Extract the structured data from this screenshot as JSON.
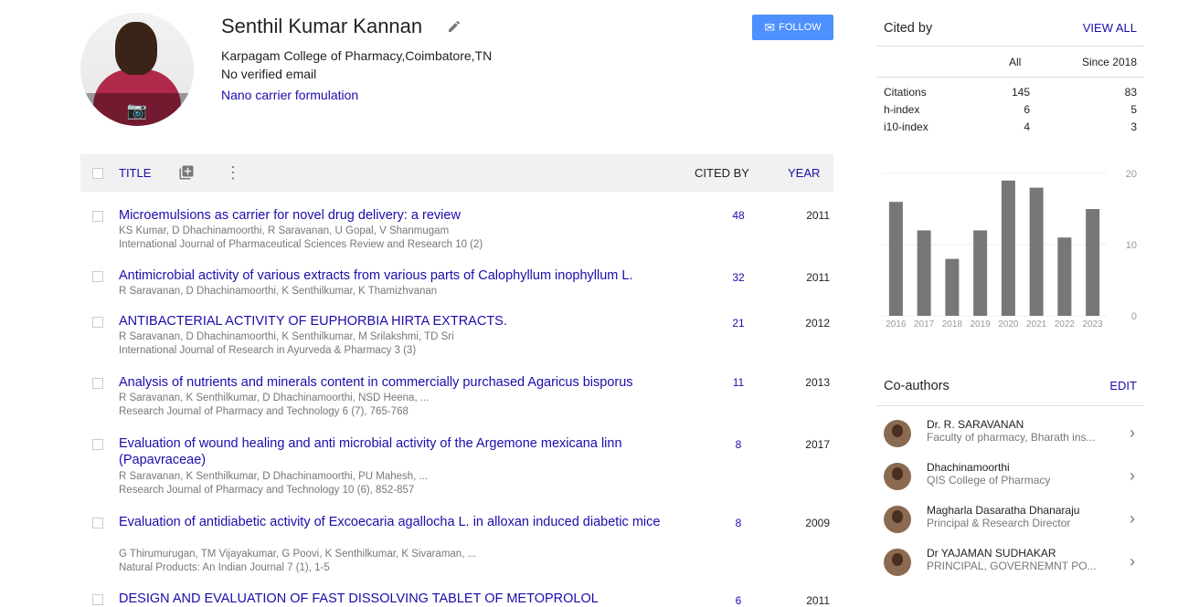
{
  "profile": {
    "name": "Senthil Kumar Kannan",
    "affiliation": "Karpagam College of Pharmacy,Coimbatore,TN",
    "email": "No verified email",
    "interest": "Nano carrier formulation",
    "follow_label": "FOLLOW"
  },
  "table_header": {
    "title": "TITLE",
    "cited_by": "CITED BY",
    "year": "YEAR"
  },
  "articles": [
    {
      "title": "Microemulsions as carrier for novel drug delivery: a review",
      "authors": "KS Kumar, D Dhachinamoorthi, R Saravanan, U Gopal, V Shanmugam",
      "publication": "International Journal of Pharmaceutical Sciences Review and Research 10 (2)",
      "cited": "48",
      "year": "2011"
    },
    {
      "title": "Antimicrobial activity of various extracts from various parts of Calophyllum inophyllum L.",
      "authors": "R Saravanan, D Dhachinamoorthi, K Senthilkumar, K Thamizhvanan",
      "publication": "",
      "cited": "32",
      "year": "2011"
    },
    {
      "title": "ANTIBACTERIAL ACTIVITY OF EUPHORBIA HIRTA EXTRACTS.",
      "authors": "R Saravanan, D Dhachinamoorthi, K Senthilkumar, M Srilakshmi, TD Sri",
      "publication": "International Journal of Research in Ayurveda & Pharmacy 3 (3)",
      "cited": "21",
      "year": "2012"
    },
    {
      "title": "Analysis of nutrients and minerals content in commercially purchased Agaricus bisporus",
      "authors": "R Saravanan, K Senthilkumar, D Dhachinamoorthi, NSD Heena, ...",
      "publication": "Research Journal of Pharmacy and Technology 6 (7), 765-768",
      "cited": "11",
      "year": "2013"
    },
    {
      "title": "Evaluation of wound healing and anti microbial activity of the Argemone mexicana linn (Papavraceae)",
      "authors": "R Saravanan, K Senthilkumar, D Dhachinamoorthi, PU Mahesh, ...",
      "publication": "Research Journal of Pharmacy and Technology 10 (6), 852-857",
      "cited": "8",
      "year": "2017"
    },
    {
      "title": "Evaluation of antidiabetic activity of Excoecaria agallocha L. in alloxan induced diabetic mice",
      "authors": "G Thirumurugan, TM Vijayakumar, G Poovi, K Senthilkumar, K Sivaraman, ...",
      "publication": "Natural Products: An Indian Journal 7 (1), 1-5",
      "cited": "8",
      "year": "2009"
    },
    {
      "title": "DESIGN AND EVALUATION OF FAST DISSOLVING TABLET OF METOPROLOL",
      "authors": "",
      "publication": "",
      "cited": "6",
      "year": "2011"
    }
  ],
  "cited_by": {
    "heading": "Cited by",
    "view_all": "VIEW ALL",
    "col_all": "All",
    "col_since": "Since 2018",
    "rows": [
      {
        "label": "Citations",
        "all": "145",
        "since": "83"
      },
      {
        "label": "h-index",
        "all": "6",
        "since": "5"
      },
      {
        "label": "i10-index",
        "all": "4",
        "since": "3"
      }
    ]
  },
  "chart_data": {
    "type": "bar",
    "categories": [
      "2016",
      "2017",
      "2018",
      "2019",
      "2020",
      "2021",
      "2022",
      "2023"
    ],
    "values": [
      16,
      12,
      8,
      12,
      19,
      18,
      11,
      15
    ],
    "ylim": [
      0,
      20
    ],
    "yticks": [
      "20",
      "10",
      "0"
    ],
    "color": "#777777",
    "grid": true
  },
  "coauthors": {
    "heading": "Co-authors",
    "edit": "EDIT",
    "items": [
      {
        "name": "Dr. R. SARAVANAN",
        "desc": "Faculty of pharmacy, Bharath ins..."
      },
      {
        "name": "Dhachinamoorthi",
        "desc": "QIS College of Pharmacy"
      },
      {
        "name": "Magharla Dasaratha Dhanaraju",
        "desc": "Principal & Research Director"
      },
      {
        "name": "Dr YAJAMAN SUDHAKAR",
        "desc": "PRINCIPAL, GOVERNEMNT PO..."
      }
    ]
  }
}
